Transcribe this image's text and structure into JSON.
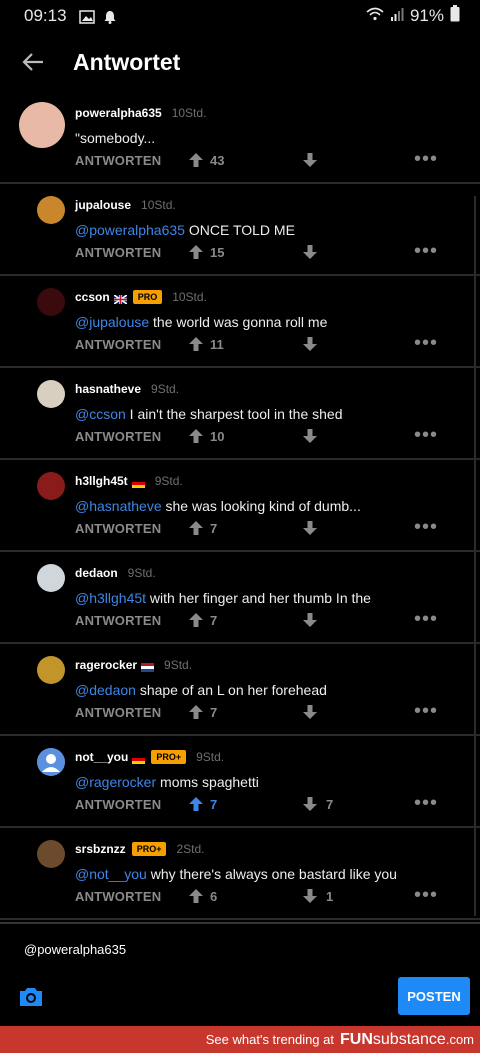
{
  "status": {
    "time": "09:13",
    "battery": "91%"
  },
  "header": {
    "title": "Antwortet"
  },
  "reply_label": "ANTWORTEN",
  "comments": [
    {
      "user": "poweralpha635",
      "flag": "",
      "badge": "",
      "time": "10Std.",
      "mention": "",
      "text": "\"somebody...",
      "up": "43",
      "down": "",
      "up_active": false
    },
    {
      "user": "jupalouse",
      "flag": "",
      "badge": "",
      "time": "10Std.",
      "mention": "@poweralpha635",
      "text": " ONCE TOLD ME",
      "up": "15",
      "down": "",
      "up_active": false
    },
    {
      "user": "ccson",
      "flag": "uk",
      "badge": "PRO",
      "time": "10Std.",
      "mention": "@jupalouse",
      "text": " the world was gonna roll me",
      "up": "11",
      "down": "",
      "up_active": false
    },
    {
      "user": "hasnatheve",
      "flag": "",
      "badge": "",
      "time": "9Std.",
      "mention": "@ccson",
      "text": " I ain't the sharpest tool in the shed",
      "up": "10",
      "down": "",
      "up_active": false
    },
    {
      "user": "h3llgh45t",
      "flag": "de",
      "badge": "",
      "time": "9Std.",
      "mention": "@hasnatheve",
      "text": " she was looking kind of dumb...",
      "up": "7",
      "down": "",
      "up_active": false
    },
    {
      "user": "dedaon",
      "flag": "",
      "badge": "",
      "time": "9Std.",
      "mention": "@h3llgh45t",
      "text": " with her finger and her thumb In the",
      "up": "7",
      "down": "",
      "up_active": false
    },
    {
      "user": "ragerocker",
      "flag": "nl",
      "badge": "",
      "time": "9Std.",
      "mention": "@dedaon",
      "text": " shape of an L on her forehead",
      "up": "7",
      "down": "",
      "up_active": false
    },
    {
      "user": "not__you",
      "flag": "de",
      "badge": "PRO+",
      "time": "9Std.",
      "mention": "@ragerocker",
      "text": " moms spaghetti",
      "up": "7",
      "down": "7",
      "up_active": true
    },
    {
      "user": "srsbznzz",
      "flag": "",
      "badge": "PRO+",
      "time": "2Std.",
      "mention": "@not__you",
      "text": " why there's always one bastard like you",
      "up": "6",
      "down": "1",
      "up_active": false
    }
  ],
  "input": {
    "value": "@poweralpha635"
  },
  "post_label": "POSTEN",
  "footer": {
    "text": "See what's trending at",
    "brand_a": "FUN",
    "brand_b": "substance",
    "brand_c": ".com"
  },
  "colors": {
    "mention": "#3d86e8",
    "pro_badge": "#f5a000",
    "post_button": "#1e8af8",
    "footer_bg": "#c8372e"
  }
}
